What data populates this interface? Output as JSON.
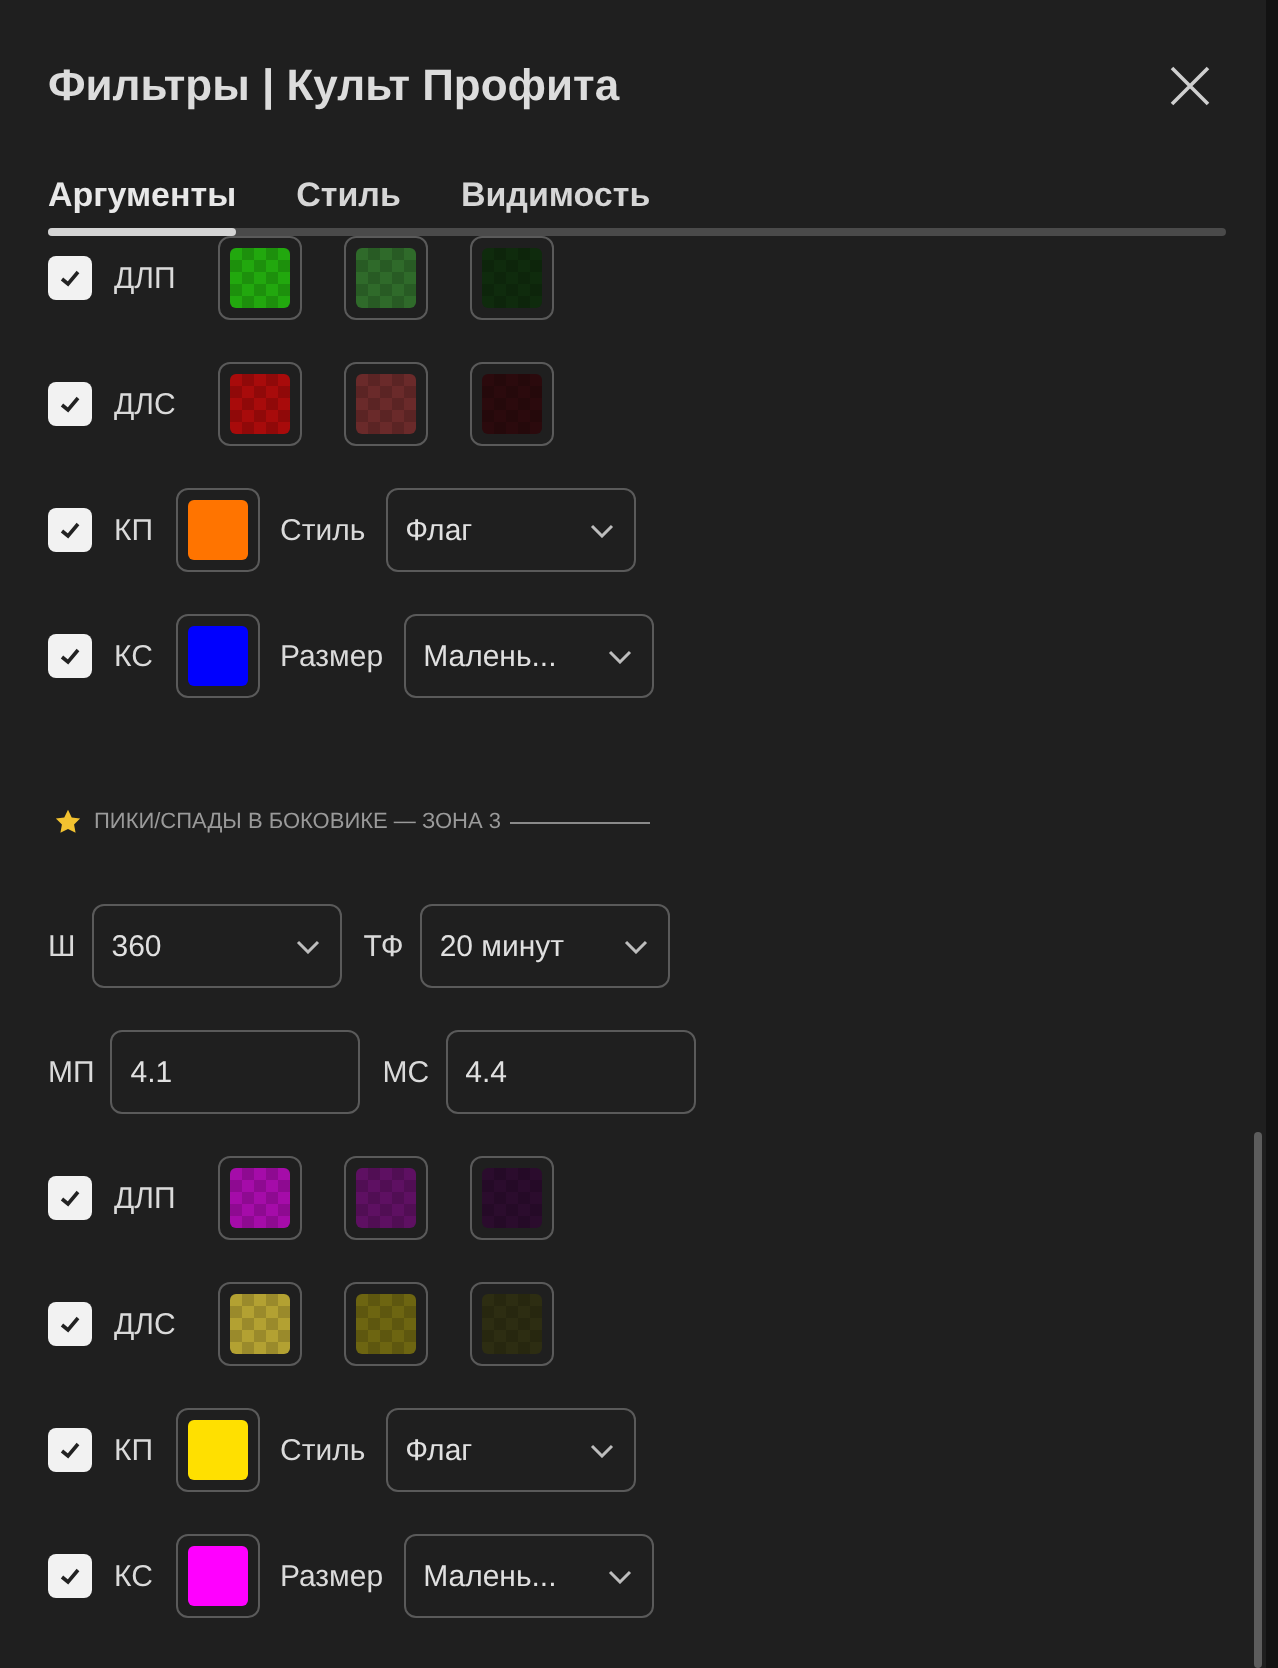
{
  "dialog": {
    "title": "Фильтры | Культ Профита"
  },
  "tabs": [
    {
      "label": "Аргументы",
      "selected": true
    },
    {
      "label": "Стиль",
      "selected": false
    },
    {
      "label": "Видимость",
      "selected": false
    }
  ],
  "rows": [
    {
      "kind": "swatches",
      "checked": true,
      "label": "ДЛП",
      "swatches": [
        {
          "kind": "checkered",
          "color": "#22a80e"
        },
        {
          "kind": "checkered",
          "color": "#2f6a2a"
        },
        {
          "kind": "checkered",
          "color": "#0f2b0d"
        }
      ]
    },
    {
      "kind": "swatches",
      "checked": true,
      "label": "ДЛС",
      "swatches": [
        {
          "kind": "checkered",
          "color": "#a80b0b"
        },
        {
          "kind": "checkered",
          "color": "#6a2a2a"
        },
        {
          "kind": "checkered",
          "color": "#2b0a0d"
        }
      ]
    },
    {
      "kind": "marker",
      "checked": true,
      "label": "КП",
      "swatch": {
        "kind": "solid",
        "color": "#ff7400"
      },
      "option": "Стиль",
      "value": "Флаг"
    },
    {
      "kind": "marker",
      "checked": true,
      "label": "КС",
      "swatch": {
        "kind": "solid",
        "color": "#0000ff"
      },
      "option": "Размер",
      "value": "Малень..."
    },
    {
      "kind": "header",
      "text": "ПИКИ/СПАДЫ В БОКОВИКЕ — ЗОНА 3"
    },
    {
      "kind": "select-pair",
      "fields": [
        {
          "label": "Ш",
          "value": "360"
        },
        {
          "label": "ТФ",
          "value": "20 минут"
        }
      ]
    },
    {
      "kind": "input-pair",
      "fields": [
        {
          "label": "МП",
          "value": "4.1"
        },
        {
          "label": "МС",
          "value": "4.4"
        }
      ]
    },
    {
      "kind": "swatches",
      "checked": true,
      "label": "ДЛП",
      "swatches": [
        {
          "kind": "checkered",
          "color": "#a50ca9"
        },
        {
          "kind": "checkered",
          "color": "#5e1062"
        },
        {
          "kind": "checkered",
          "color": "#2b0c2d"
        }
      ]
    },
    {
      "kind": "swatches",
      "checked": true,
      "label": "ДЛС",
      "swatches": [
        {
          "kind": "checkered",
          "color": "#b3a132"
        },
        {
          "kind": "checkered",
          "color": "#6d6511"
        },
        {
          "kind": "checkered",
          "color": "#2d2d12"
        }
      ]
    },
    {
      "kind": "marker",
      "checked": true,
      "label": "КП",
      "swatch": {
        "kind": "solid",
        "color": "#ffe000"
      },
      "option": "Стиль",
      "value": "Флаг"
    },
    {
      "kind": "marker",
      "checked": true,
      "label": "КС",
      "swatch": {
        "kind": "solid",
        "color": "#ff00ff"
      },
      "option": "Размер",
      "value": "Малень..."
    }
  ]
}
